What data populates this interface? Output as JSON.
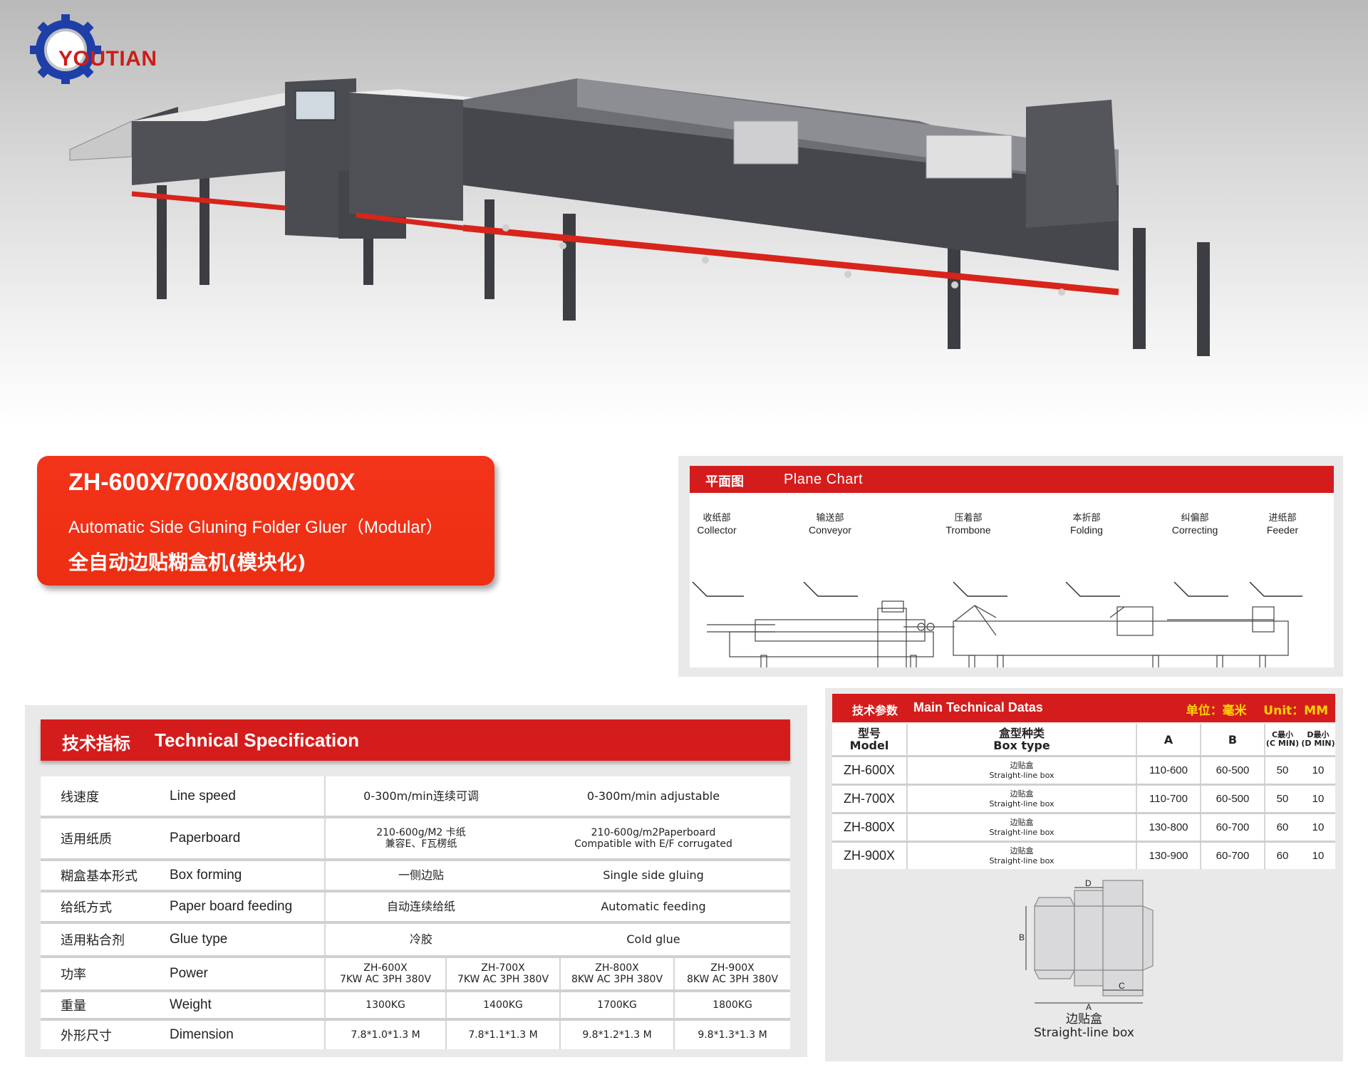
{
  "brand": {
    "name": "YOUTIAN",
    "colors": {
      "red": "#d51c1c",
      "blue": "#1e3fa8",
      "card": "#f0331a"
    }
  },
  "product": {
    "models": "ZH-600X/700X/800X/900X",
    "name_en": "Automatic Side Gluning Folder Gluer（Modular）",
    "name_cn": "全自动边贴糊盒机(模块化)"
  },
  "plane_chart": {
    "title_cn": "平面图",
    "title_en": "Plane Chart",
    "sections": [
      {
        "cn": "收纸部",
        "en": "Collector"
      },
      {
        "cn": "输送部",
        "en": "Conveyor"
      },
      {
        "cn": "压着部",
        "en": "Trombone"
      },
      {
        "cn": "本折部",
        "en": "Folding"
      },
      {
        "cn": "纠偏部",
        "en": "Correcting"
      },
      {
        "cn": "进纸部",
        "en": "Feeder"
      }
    ]
  },
  "tech_spec": {
    "title_cn": "技术指标",
    "title_en": "Technical Specification",
    "rows": [
      {
        "cn": "线速度",
        "en": "Line speed",
        "v_cn": "0-300m/min连续可调",
        "v_en": "0-300m/min adjustable"
      },
      {
        "cn": "适用纸质",
        "en": "Paperboard",
        "v_cn": "210-600g/M2 卡纸\n兼容E、F瓦楞纸",
        "v_en": "210-600g/m2Paperboard\nCompatible with E/F corrugated"
      },
      {
        "cn": "糊盒基本形式",
        "en": "Box forming",
        "v_cn": "一侧边贴",
        "v_en": "Single side gluing"
      },
      {
        "cn": "给纸方式",
        "en": "Paper board feeding",
        "v_cn": "自动连续给纸",
        "v_en": "Automatic feeding"
      },
      {
        "cn": "适用粘合剂",
        "en": "Glue type",
        "v_cn": "冷胶",
        "v_en": "Cold glue"
      }
    ],
    "model_rows": [
      {
        "cn": "功率",
        "en": "Power",
        "values": [
          "ZH-600X\n7KW AC 3PH 380V",
          "ZH-700X\n7KW  AC 3PH 380V",
          "ZH-800X\n8KW  AC 3PH 380V",
          "ZH-900X\n8KW AC 3PH 380V"
        ]
      },
      {
        "cn": "重量",
        "en": "Weight",
        "values": [
          "1300KG",
          "1400KG",
          "1700KG",
          "1800KG"
        ]
      },
      {
        "cn": "外形尺寸",
        "en": "Dimension",
        "values": [
          "7.8*1.0*1.3 M",
          "7.8*1.1*1.3 M",
          "9.8*1.2*1.3 M",
          "9.8*1.3*1.3 M"
        ]
      }
    ]
  },
  "main_data": {
    "title_cn": "技术参数",
    "title_en": "Main Technical Datas",
    "unit": "单位：毫米    Unit：MM",
    "headers": {
      "model_cn": "型号",
      "model_en": "Model",
      "box_cn": "盒型种类",
      "box_en": "Box type",
      "a": "A",
      "b": "B",
      "c_cn": "C最小",
      "c_en": "(C MIN)",
      "d_cn": "D最小",
      "d_en": "(D MIN)"
    },
    "rows": [
      {
        "model": "ZH-600X",
        "box_cn": "边贴盒",
        "box_en": "Straight-line box",
        "a": "110-600",
        "b": "60-500",
        "c": "50",
        "d": "10"
      },
      {
        "model": "ZH-700X",
        "box_cn": "边贴盒",
        "box_en": "Straight-line box",
        "a": "110-700",
        "b": "60-500",
        "c": "50",
        "d": "10"
      },
      {
        "model": "ZH-800X",
        "box_cn": "边贴盒",
        "box_en": "Straight-line box",
        "a": "130-800",
        "b": "60-700",
        "c": "60",
        "d": "10"
      },
      {
        "model": "ZH-900X",
        "box_cn": "边贴盒",
        "box_en": "Straight-line box",
        "a": "130-900",
        "b": "60-700",
        "c": "60",
        "d": "10"
      }
    ],
    "diagram_labels": {
      "a": "A",
      "b": "B",
      "c": "C",
      "d": "D"
    },
    "box_caption_cn": "边贴盒",
    "box_caption_en": "Straight-line box"
  }
}
